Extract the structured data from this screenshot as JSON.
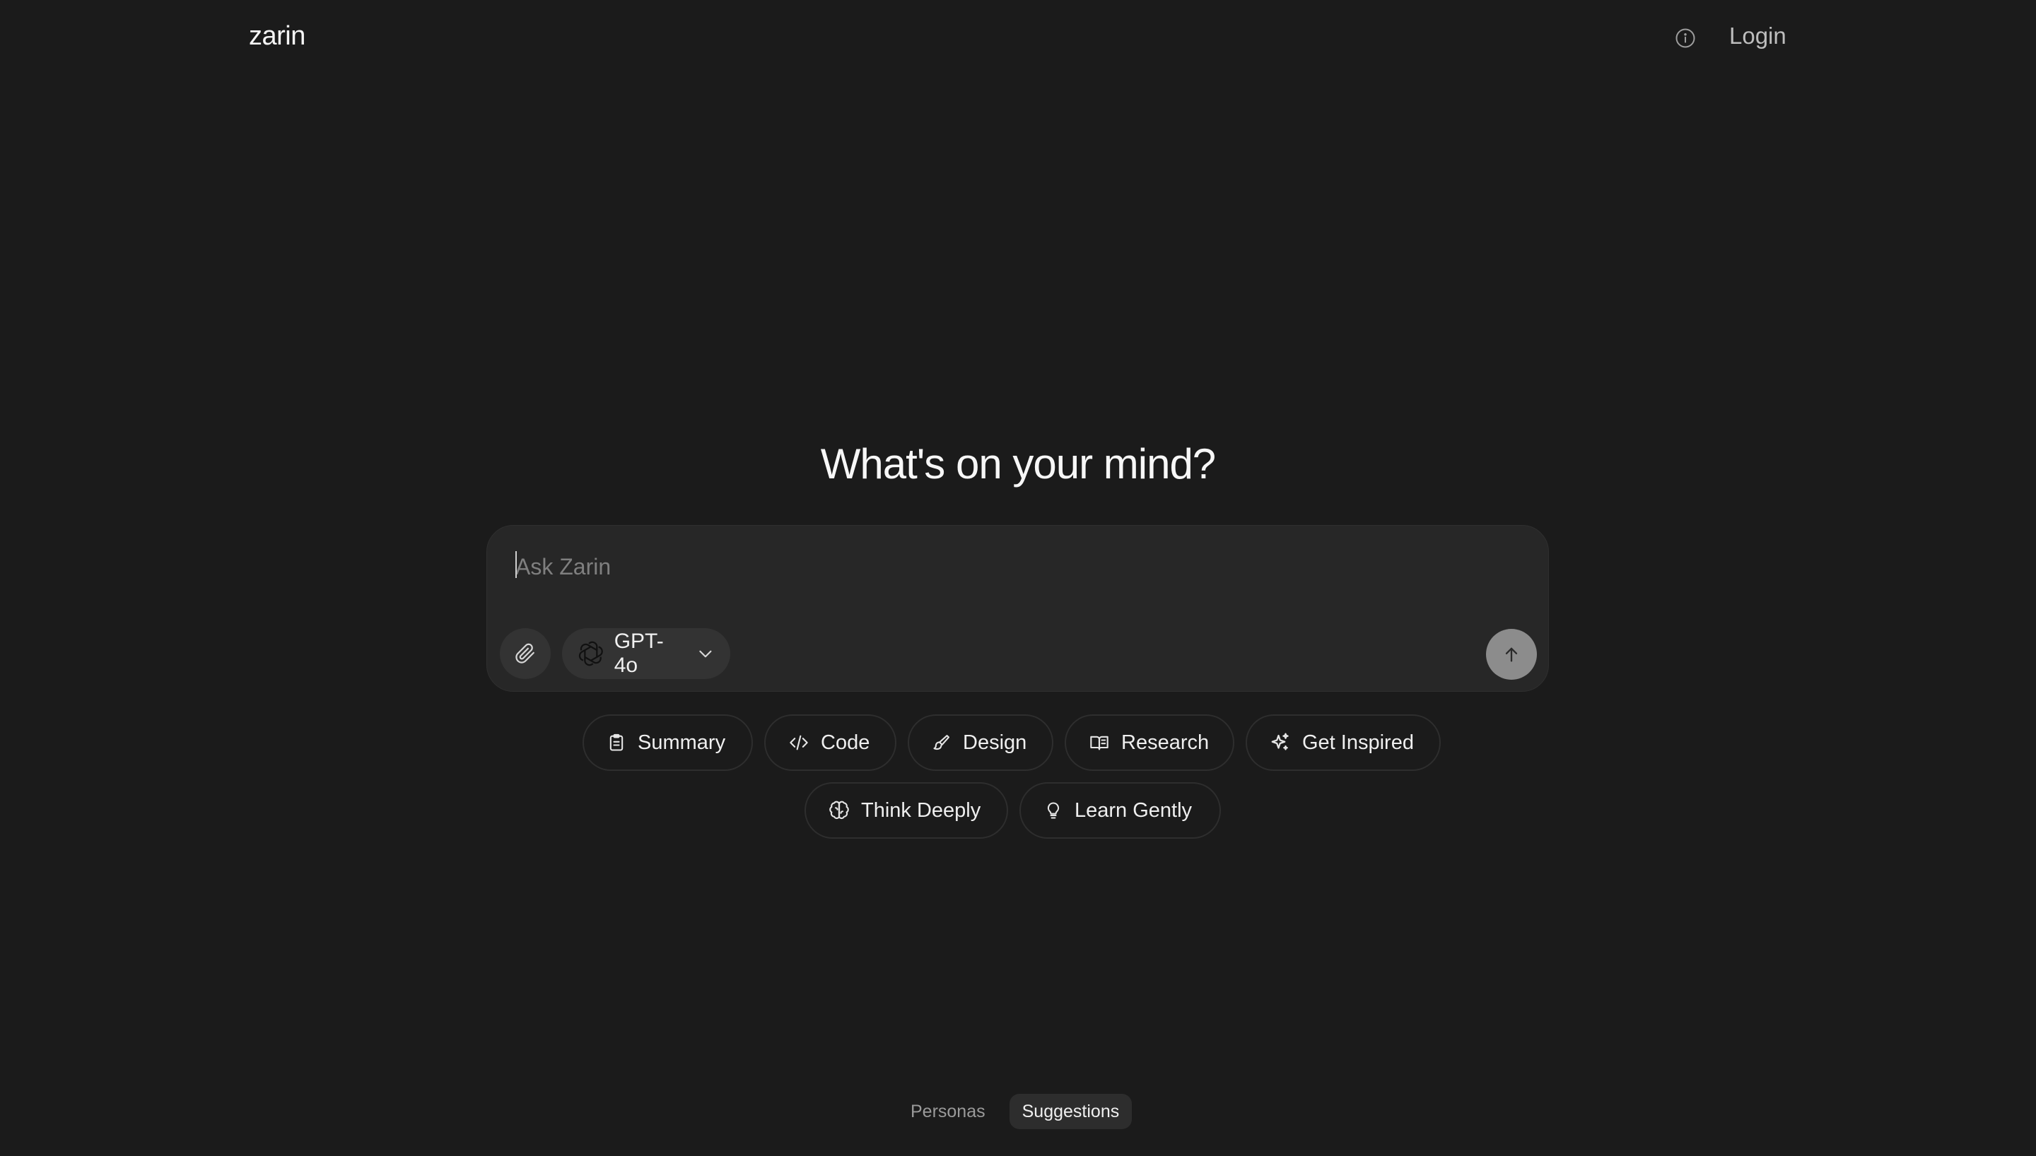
{
  "header": {
    "brand": "zarin",
    "info_icon": "info-icon",
    "login_label": "Login"
  },
  "main": {
    "headline": "What's on your mind?"
  },
  "composer": {
    "placeholder": "Ask Zarin",
    "value": "",
    "attach_icon": "paperclip-icon",
    "model": {
      "label": "GPT-4o",
      "icon": "openai-logo-icon",
      "chevron_icon": "chevron-down-icon"
    },
    "send_icon": "arrow-up-icon"
  },
  "suggestions": [
    {
      "label": "Summary",
      "icon": "clipboard-icon"
    },
    {
      "label": "Code",
      "icon": "code-icon"
    },
    {
      "label": "Design",
      "icon": "paintbrush-icon"
    },
    {
      "label": "Research",
      "icon": "book-open-icon"
    },
    {
      "label": "Get Inspired",
      "icon": "sparkles-icon"
    },
    {
      "label": "Think Deeply",
      "icon": "brain-icon"
    },
    {
      "label": "Learn Gently",
      "icon": "lightbulb-icon"
    }
  ],
  "bottom_tabs": {
    "items": [
      {
        "label": "Personas",
        "active": false
      },
      {
        "label": "Suggestions",
        "active": true
      }
    ]
  },
  "colors": {
    "background": "#1b1b1b",
    "composer_bg": "#272727",
    "send_button": "#8c8c8c",
    "text_primary": "#f2f2f2",
    "text_muted": "#9a9a9a"
  }
}
